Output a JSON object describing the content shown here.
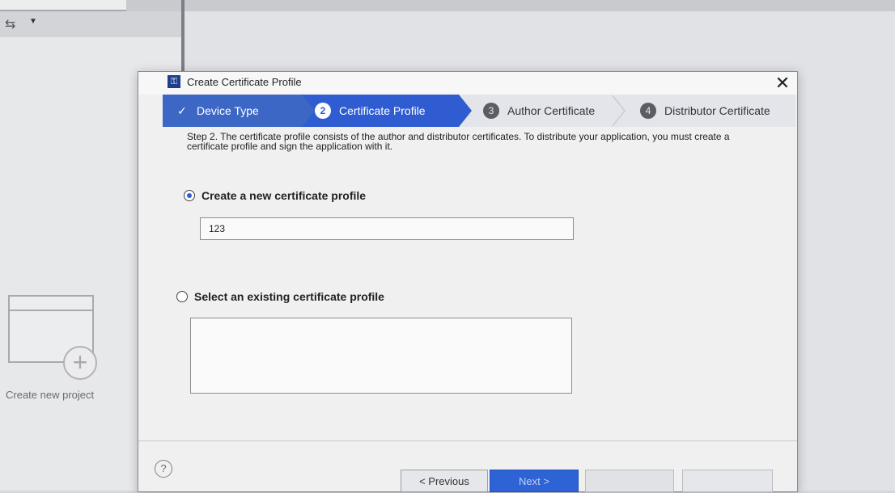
{
  "ide": {
    "create_new_project_label": "Create new project"
  },
  "dialog": {
    "title": "Create Certificate Profile",
    "close_glyph": "✕",
    "steps": [
      {
        "label": "Device Type",
        "state": "done"
      },
      {
        "number": "2",
        "label": "Certificate Profile",
        "state": "active"
      },
      {
        "number": "3",
        "label": "Author Certificate",
        "state": "pending"
      },
      {
        "number": "4",
        "label": "Distributor Certificate",
        "state": "pending"
      }
    ],
    "description": "Step 2. The certificate profile consists of the author and distributor certificates. To distribute your application, you must create a certificate profile and sign the application with it.",
    "option_new_label": "Create a new certificate profile",
    "option_new_selected": true,
    "profile_name_value": "123",
    "option_existing_label": "Select an existing certificate profile",
    "option_existing_selected": false,
    "buttons": {
      "previous": "< Previous",
      "next": "Next >",
      "finish": "",
      "cancel": ""
    },
    "help_glyph": "?"
  },
  "colors": {
    "step_active": "#2f5cd0",
    "step_done": "#3c67c5",
    "next_button": "#2e63d6"
  }
}
